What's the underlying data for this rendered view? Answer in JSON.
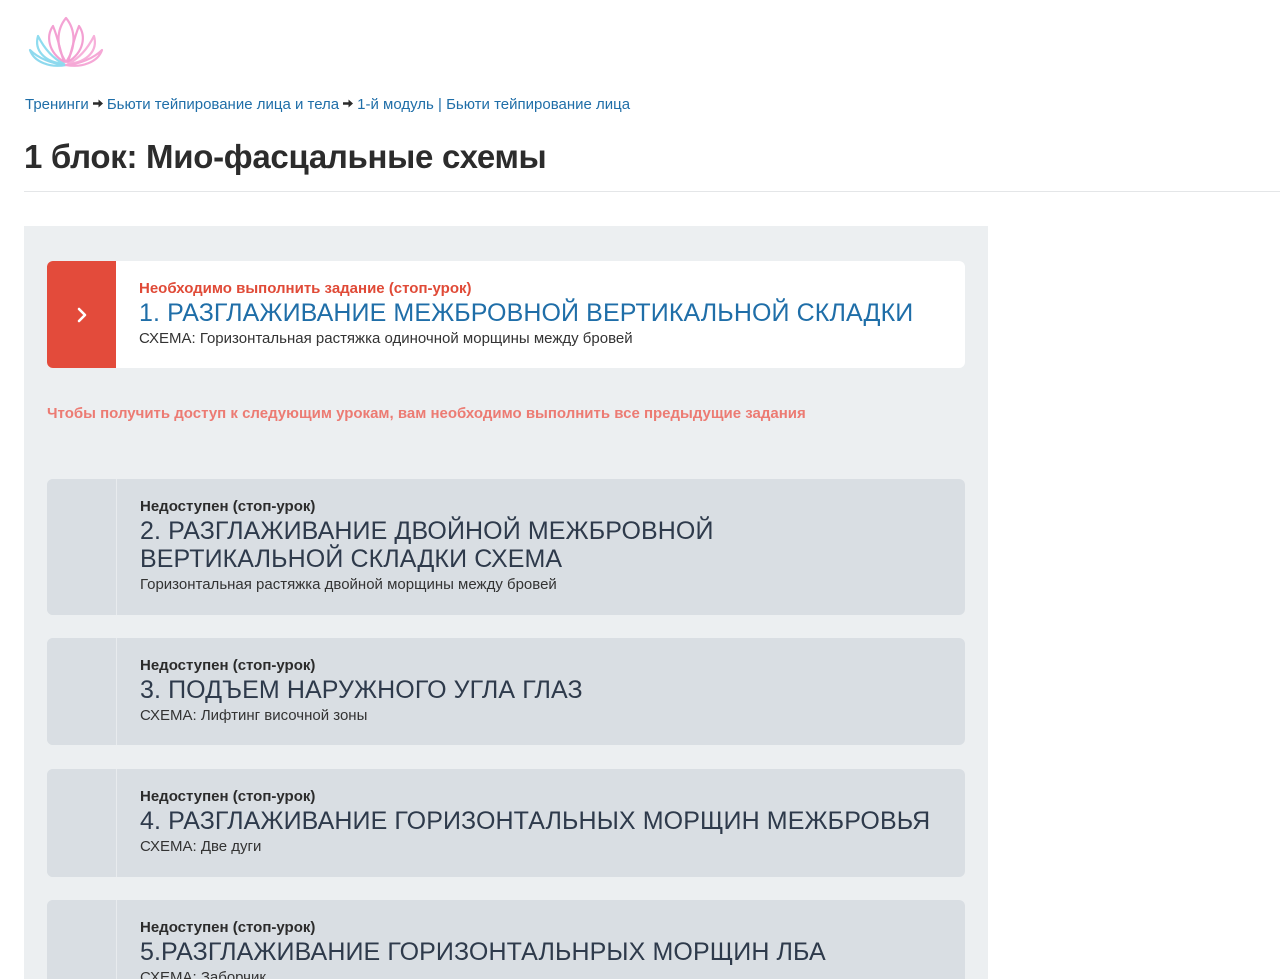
{
  "breadcrumb": {
    "items": [
      "Тренинги",
      "Бьюти тейпирование лица и тела",
      "1-й модуль | Бьюти тейпирование лица"
    ]
  },
  "page": {
    "title": "1 блок: Мио-фасцальные схемы"
  },
  "icons": {
    "logo": "lotus-logo",
    "active_indicator": "chevron-right-icon",
    "separator": "arrow-right-icon"
  },
  "colors": {
    "accent_red": "#e34b3b",
    "link_blue": "#1f6ea8",
    "warning_text": "#ec7b73",
    "locked_bg": "#d9dee3"
  },
  "lessons": [
    {
      "status": "Необходимо выполнить задание (стоп-урок)",
      "title": "1. РАЗГЛАЖИВАНИЕ МЕЖБРОВНОЙ ВЕРТИКАЛЬНОЙ СКЛАДКИ",
      "subtitle": "СХЕМА: Горизонтальная растяжка одиночной морщины между бровей"
    },
    {
      "status": "Недоступен (стоп-урок)",
      "title": "2. РАЗГЛАЖИВАНИЕ ДВОЙНОЙ МЕЖБРОВНОЙ ВЕРТИКАЛЬНОЙ СКЛАДКИ СХЕМА",
      "subtitle": "Горизонтальная растяжка двойной морщины между бровей"
    },
    {
      "status": "Недоступен (стоп-урок)",
      "title": "3. ПОДЪЕМ НАРУЖНОГО УГЛА ГЛАЗ",
      "subtitle": "СХЕМА: Лифтинг височной зоны"
    },
    {
      "status": "Недоступен (стоп-урок)",
      "title": "4. РАЗГЛАЖИВАНИЕ ГОРИЗОНТАЛЬНЫХ МОРЩИН МЕЖБРОВЬЯ",
      "subtitle": "СХЕМА: Две дуги"
    },
    {
      "status": "Недоступен (стоп-урок)",
      "title": "5.РАЗГЛАЖИВАНИЕ ГОРИЗОНТАЛЬНРЫХ МОРЩИН ЛБА",
      "subtitle": "СХЕМА: Заборчик"
    }
  ],
  "access_note": "Чтобы получить доступ к следующим урокам, вам необходимо выполнить все предыдущие задания"
}
